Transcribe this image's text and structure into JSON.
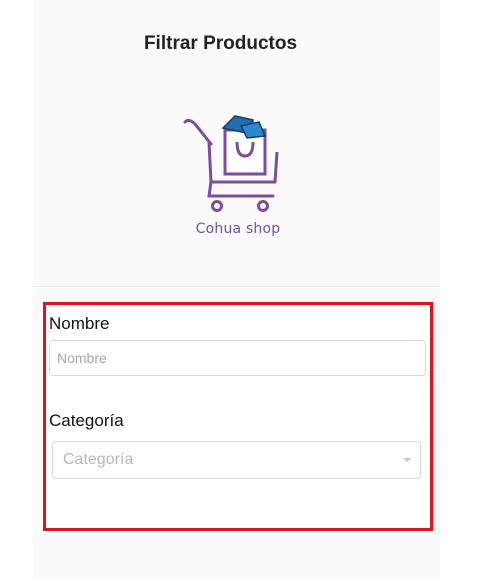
{
  "header": {
    "title": "Filtrar Productos",
    "logo_text": "Cohua shop",
    "logo_icon": "shopping-cart-with-bag-icon"
  },
  "filters": {
    "nombre": {
      "label": "Nombre",
      "placeholder": "Nombre",
      "value": ""
    },
    "categoria": {
      "label": "Categoría",
      "placeholder": "Categoría",
      "arrow_icon": "chevron-down-icon"
    }
  },
  "colors": {
    "highlight_border": "#e0131b",
    "logo_purple": "#7b4d9b",
    "logo_blue": "#1f6fb2"
  }
}
